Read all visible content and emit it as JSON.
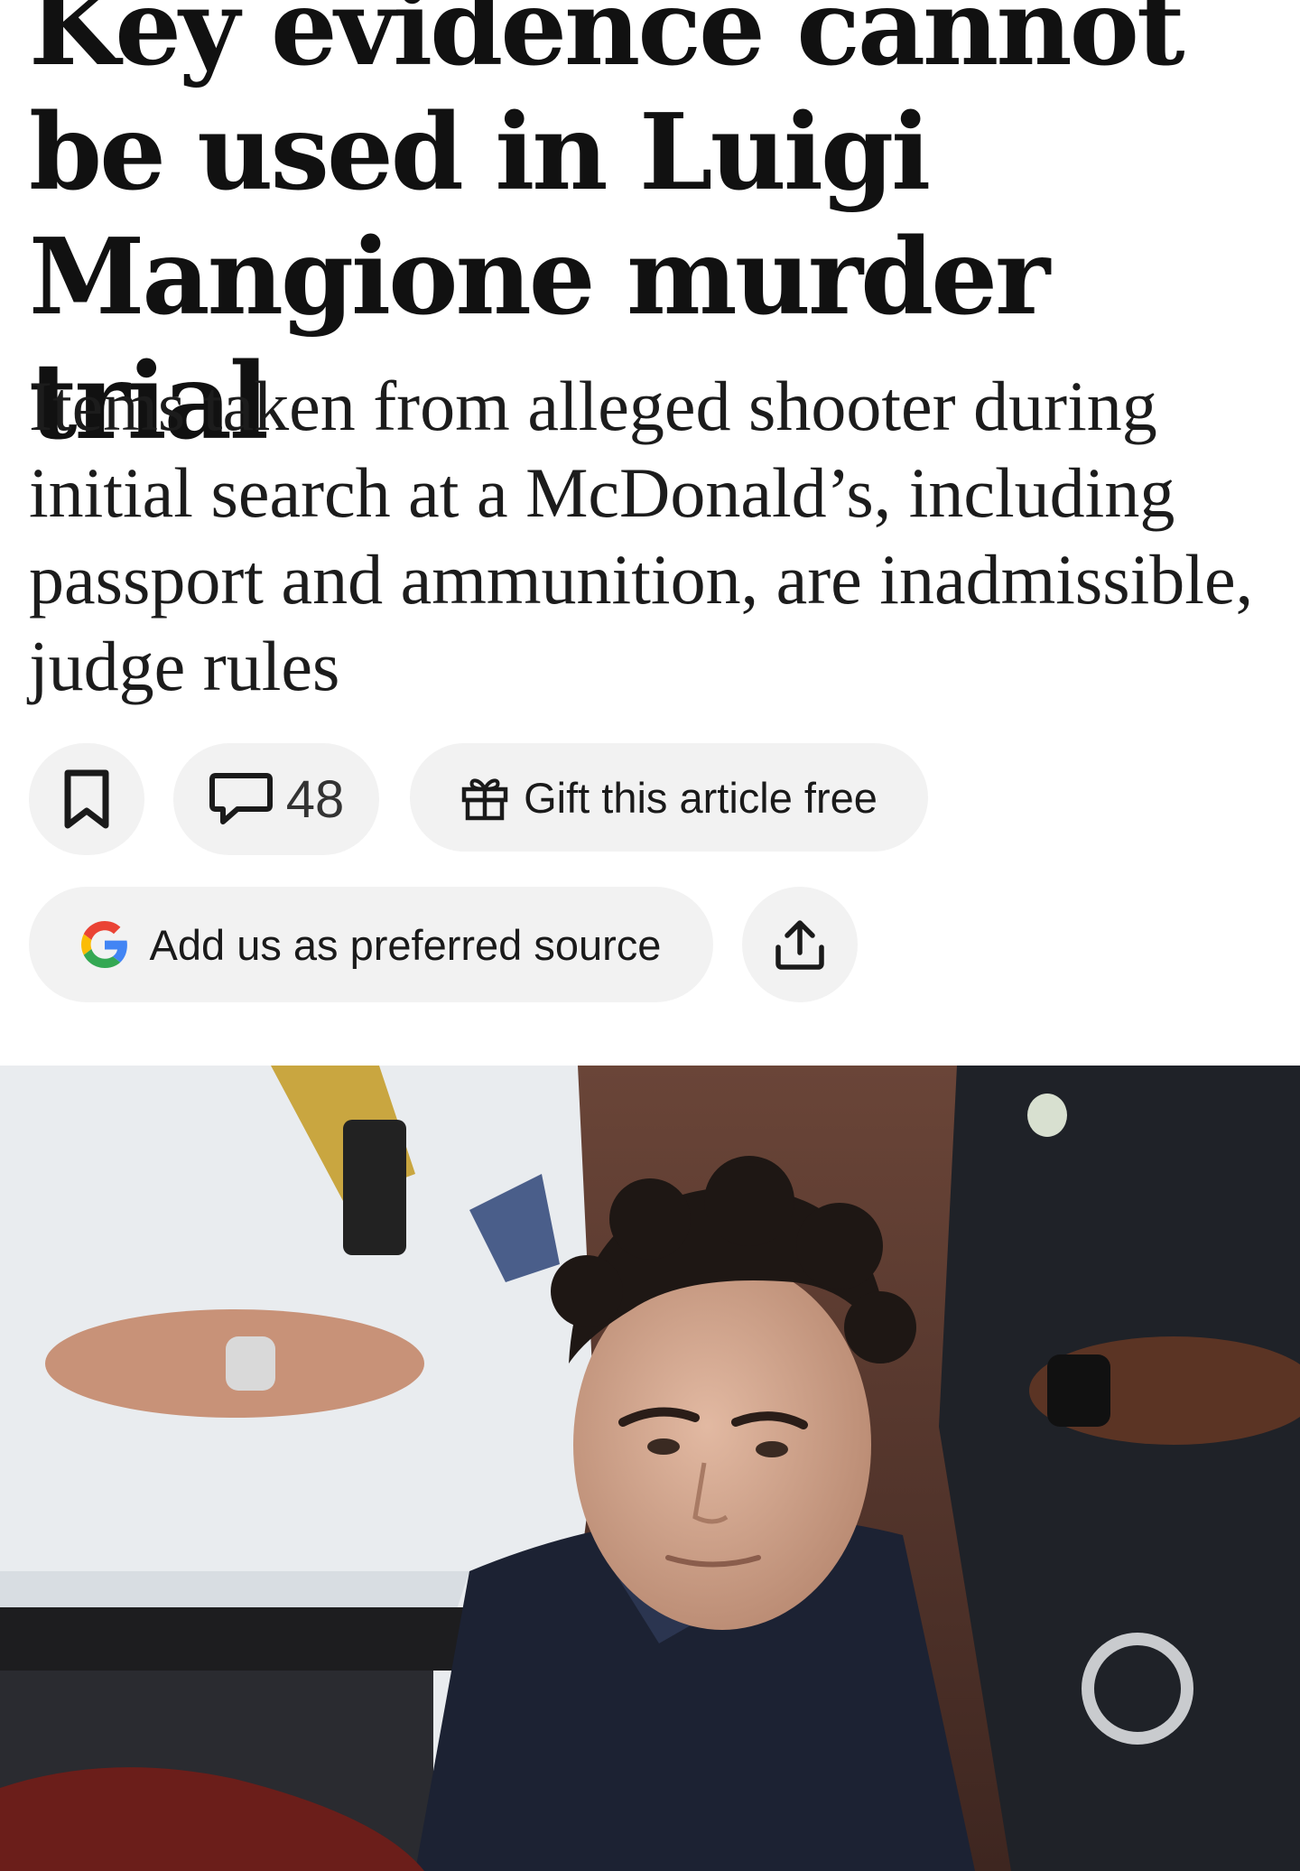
{
  "article": {
    "headline": "Key evidence cannot be used in Luigi Mangione murder trial",
    "standfirst": "Items taken from alleged shooter during initial search at a McDonald’s, including passport and ammunition, are inadmissible, judge rules"
  },
  "actions": {
    "bookmark_icon": "bookmark-icon",
    "comment_icon": "comment-icon",
    "comment_count": "48",
    "gift_icon": "gift-icon",
    "gift_label": "Gift this article free",
    "google_icon": "google-g-icon",
    "preferred_source_label": "Add us as preferred source",
    "share_icon": "share-icon"
  },
  "colors": {
    "pill_background": "#f2f2f2",
    "text": "#1a1a1a",
    "google_blue": "#4285F4",
    "google_red": "#EA4335",
    "google_yellow": "#FBBC05",
    "google_green": "#34A853"
  },
  "hero_image": {
    "depicts": "photo"
  }
}
